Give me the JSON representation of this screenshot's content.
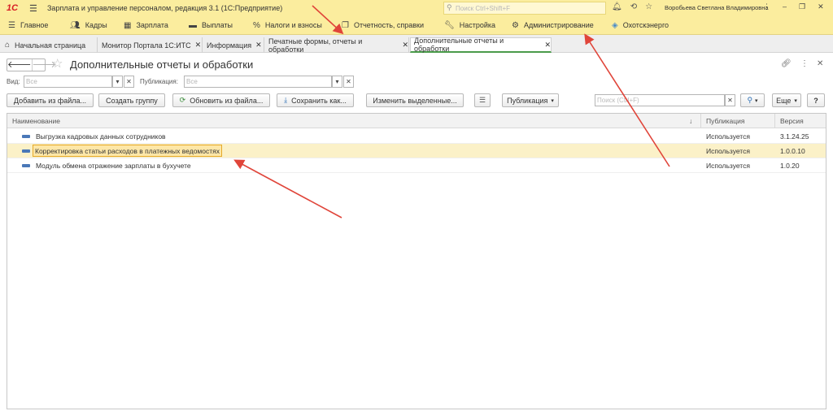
{
  "titlebar": {
    "logo": "1С",
    "app_title": "Зарплата и управление персоналом, редакция 3.1  (1С:Предприятие)",
    "search_placeholder": "Поиск Ctrl+Shift+F",
    "username": "Воробьева Светлана Владимировна"
  },
  "sections": [
    {
      "label": "Главное",
      "icon": "hamburger-menu-icon"
    },
    {
      "label": "Кадры",
      "icon": "people-icon"
    },
    {
      "label": "Зарплата",
      "icon": "calculator-icon"
    },
    {
      "label": "Выплаты",
      "icon": "wallet-icon"
    },
    {
      "label": "Налоги и взносы",
      "icon": "percent-icon"
    },
    {
      "label": "Отчетность, справки",
      "icon": "reports-icon"
    },
    {
      "label": "Настройка",
      "icon": "wrench-icon"
    },
    {
      "label": "Администрирование",
      "icon": "gear-icon"
    },
    {
      "label": "Охотскэнерго",
      "icon": "organization-icon"
    }
  ],
  "tabs": [
    {
      "label": "Начальная страница"
    },
    {
      "label": "Монитор Портала 1С:ИТС"
    },
    {
      "label": "Информация"
    },
    {
      "label": "Печатные формы, отчеты и обработки"
    },
    {
      "label": "Дополнительные отчеты и обработки"
    }
  ],
  "form": {
    "title": "Дополнительные отчеты и обработки"
  },
  "filters": {
    "kind_label": "Вид:",
    "kind_placeholder": "Все",
    "publication_label": "Публикация:",
    "publication_placeholder": "Все"
  },
  "toolbar": {
    "add_from_file": "Добавить из файла...",
    "create_group": "Создать группу",
    "update_from_file": "Обновить из файла...",
    "save_as": "Сохранить как...",
    "change_selected": "Изменить выделенные...",
    "publication": "Публикация",
    "search_placeholder": "Поиск (Ctrl+F)",
    "more": "Еще",
    "help": "?"
  },
  "table": {
    "columns": {
      "name": "Наименование",
      "publication": "Публикация",
      "version": "Версия"
    },
    "rows": [
      {
        "name": "Выгрузка кадровых данных сотрудников",
        "publication": "Используется",
        "version": "3.1.24.25"
      },
      {
        "name": "Корректировка статьи расходов в платежных ведомостях",
        "publication": "Используется",
        "version": "1.0.0.10"
      },
      {
        "name": "Модуль обмена отражение зарплаты в бухучете",
        "publication": "Используется",
        "version": "1.0.20"
      }
    ]
  },
  "colors": {
    "titlebar_bg": "#fbed9e",
    "selected_row": "#fbf1c8",
    "annotation_arrow": "#e0453a",
    "active_tab_underline": "#4a9b4a"
  }
}
